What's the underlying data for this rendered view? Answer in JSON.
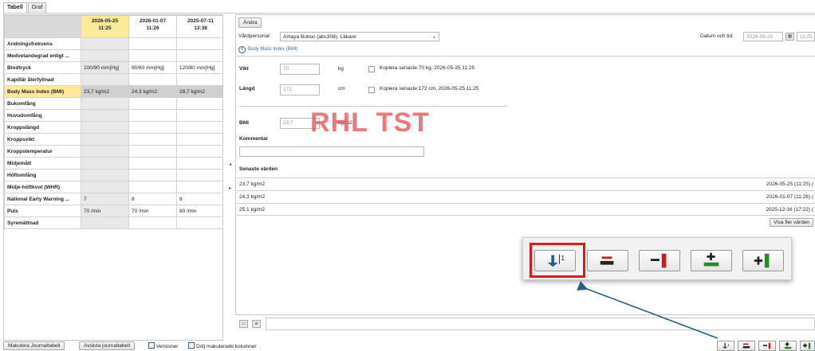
{
  "tabs": [
    {
      "label": "Tabell",
      "active": true
    },
    {
      "label": "Graf",
      "active": false
    }
  ],
  "table": {
    "columns": [
      {
        "date": "2026-05-25",
        "time": "11:25",
        "selected": true
      },
      {
        "date": "2026-01-07",
        "time": "11:26",
        "selected": false
      },
      {
        "date": "2025-07-11",
        "time": "13:38",
        "selected": false
      }
    ],
    "rows": [
      {
        "name": "Andningsfrekvens",
        "values": [
          "",
          "",
          ""
        ]
      },
      {
        "name": "Medvetandegrad enligt ...",
        "values": [
          "",
          "",
          ""
        ]
      },
      {
        "name": "Blodtryck",
        "values": [
          "100/90 mm[Hg]",
          "90/60 mm[Hg]",
          "120/80 mm[Hg]"
        ]
      },
      {
        "name": "Kapillär återfyllnad",
        "values": [
          "",
          "",
          ""
        ]
      },
      {
        "name": "Body Mass Index (BMI)",
        "values": [
          "23,7 kg/m2",
          "24,3 kg/m2",
          "28,7 kg/m2"
        ],
        "highlight": true
      },
      {
        "name": "Bukomfång",
        "values": [
          "",
          "",
          ""
        ]
      },
      {
        "name": "Huvudomfång",
        "values": [
          "",
          "",
          ""
        ]
      },
      {
        "name": "Kroppslängd",
        "values": [
          "",
          "",
          ""
        ]
      },
      {
        "name": "Kroppsvikt",
        "values": [
          "",
          "",
          ""
        ]
      },
      {
        "name": "Kroppstemperatur",
        "values": [
          "",
          "",
          ""
        ]
      },
      {
        "name": "Midjemått",
        "values": [
          "",
          "",
          ""
        ]
      },
      {
        "name": "Höftomfång",
        "values": [
          "",
          "",
          ""
        ]
      },
      {
        "name": "Midje-höftkvot (WHR)",
        "values": [
          "",
          "",
          ""
        ]
      },
      {
        "name": "National Early Warning ...",
        "values": [
          "7",
          "8",
          "8"
        ]
      },
      {
        "name": "Puls",
        "values": [
          "70 /min",
          "70 /min",
          "80 /min"
        ]
      },
      {
        "name": "Syremättnad",
        "values": [
          "",
          "",
          ""
        ]
      }
    ]
  },
  "panel": {
    "edit_button": "Ändra",
    "caregiver_label": "Vårdpersonal:",
    "caregiver_value": "Amaya Boboc (abc308), Läkare",
    "datetime_label": "Datum och tid:",
    "date_value": "2026-05-25",
    "time_value": "11:25",
    "section_title": "Body Mass Index (BMI)",
    "weight_label": "Vikt",
    "weight_value": "70",
    "weight_unit": "kg",
    "weight_copy": "Kopiera senaste:70 kg, 2026-05-25 11:25",
    "height_label": "Längd",
    "height_value": "172",
    "height_unit": "cm",
    "height_copy": "Kopiera senaste:172 cm, 2026-05-25 11:25",
    "bmi_label": "BMI",
    "bmi_value": "23,7",
    "bmi_unit": "kg/m2",
    "comment_label": "Kommentar",
    "watermark": "RHL TST",
    "recent_title": "Senaste värden",
    "recent": [
      {
        "value": "23,7 kg/m2",
        "date": "2026-05-25 (11:25) ("
      },
      {
        "value": "24,3 kg/m2",
        "date": "2026-01-07 (11:26) ("
      },
      {
        "value": "25,1 kg/m2",
        "date": "2025-12-16 (17:22) ("
      }
    ],
    "show_more": "Visa fler värden"
  },
  "bottom": {
    "cancel_table": "Makulera Journaltabell",
    "close_table": "Avsluta journaltabell",
    "versions": "Versioner",
    "hide_cancelled": "Dölj makulerade kolumner"
  },
  "colors": {
    "selected_header": "#fce99a",
    "highlight_frame": "#e01818",
    "arrow": "#2a5f86",
    "watermark": "#e55a5a"
  },
  "icons": [
    "sign-icon",
    "remove-row-icon",
    "remove-column-icon",
    "add-row-icon",
    "add-column-icon",
    "info-icon",
    "calendar-icon",
    "attachment-icon"
  ]
}
